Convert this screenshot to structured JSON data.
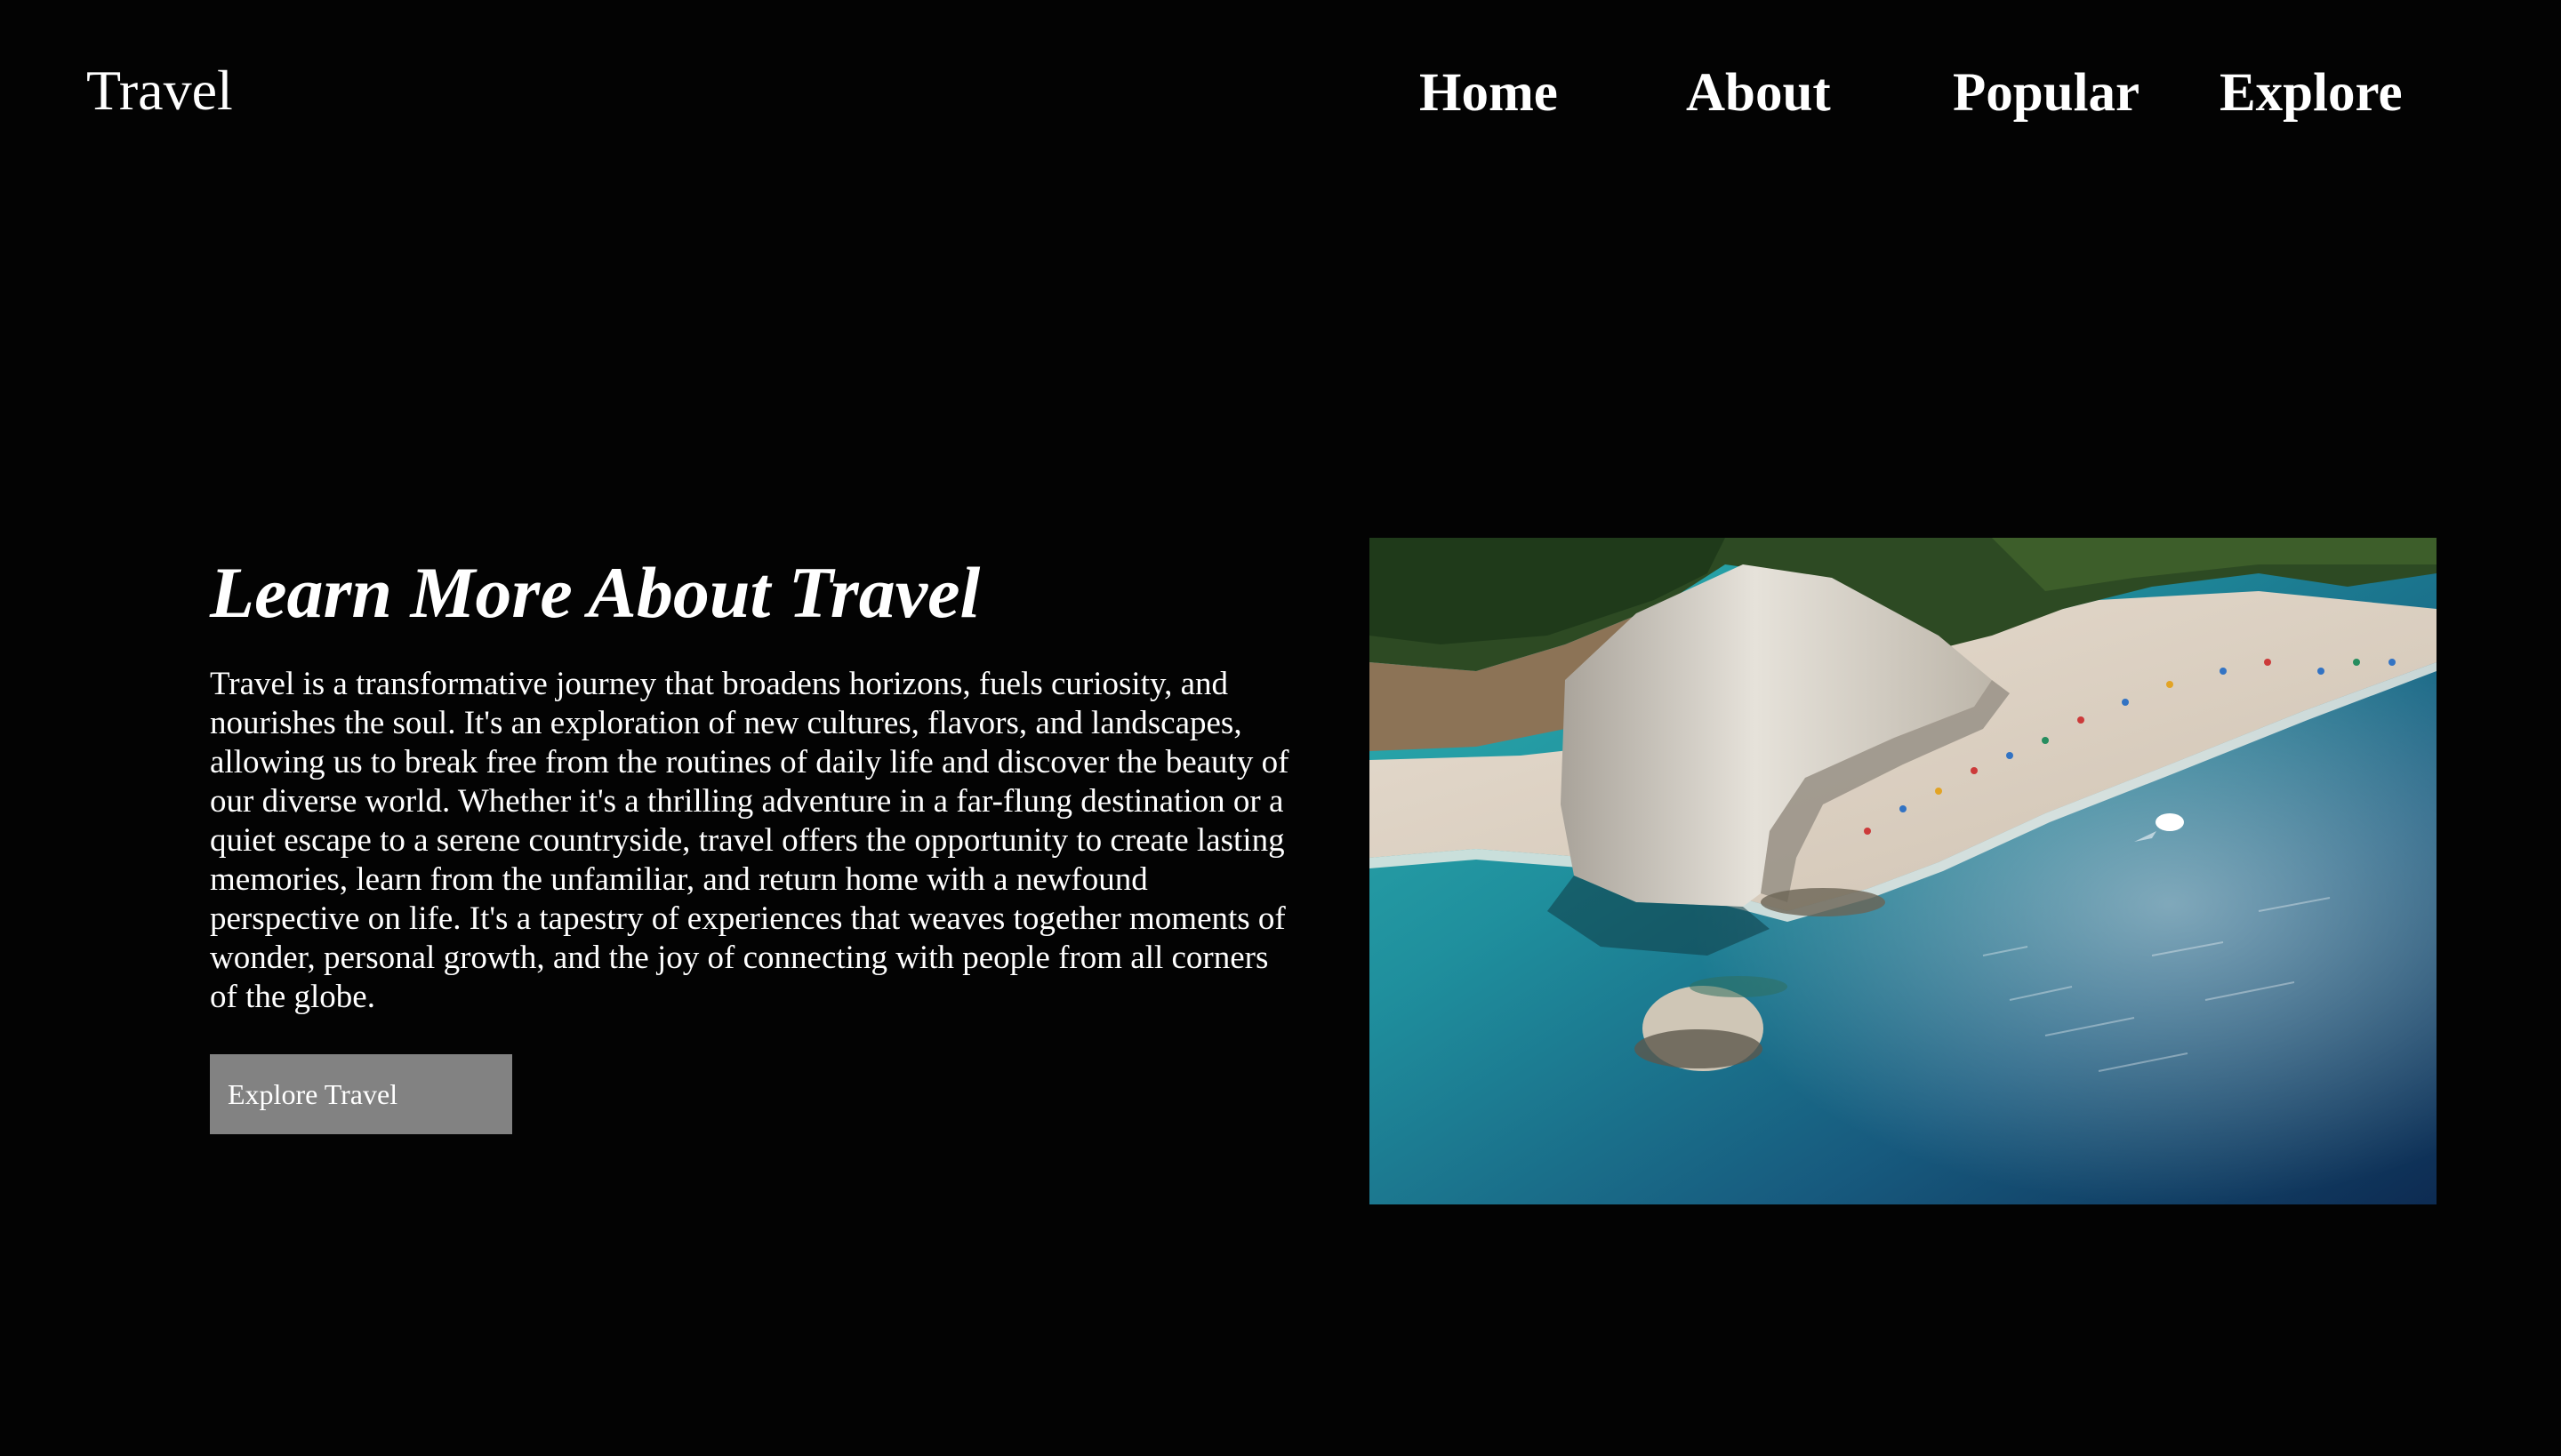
{
  "header": {
    "brand": "Travel",
    "nav": [
      {
        "label": "Home"
      },
      {
        "label": "About"
      },
      {
        "label": "Popular"
      },
      {
        "label": "Explore"
      }
    ]
  },
  "hero": {
    "title": "Learn More About Travel",
    "description": "Travel is a transformative journey that broadens horizons, fuels curiosity, and nourishes the soul. It's an exploration of new cultures, flavors, and landscapes, allowing us to break free from the routines of daily life and discover the beauty of our diverse world. Whether it's a thrilling adventure in a far-flung destination or a quiet escape to a serene countryside, travel offers the opportunity to create lasting memories, learn from the unfamiliar, and return home with a newfound perspective on life. It's a tapestry of experiences that weaves together moments of wonder, personal growth, and the joy of connecting with people from all corners of the globe.",
    "button_label": "Explore Travel",
    "image_subject": "aerial view of a beach with a white limestone cliff, turquoise sea and a small boat"
  },
  "colors": {
    "background": "#030303",
    "text": "#ffffff",
    "button": "#828282"
  }
}
